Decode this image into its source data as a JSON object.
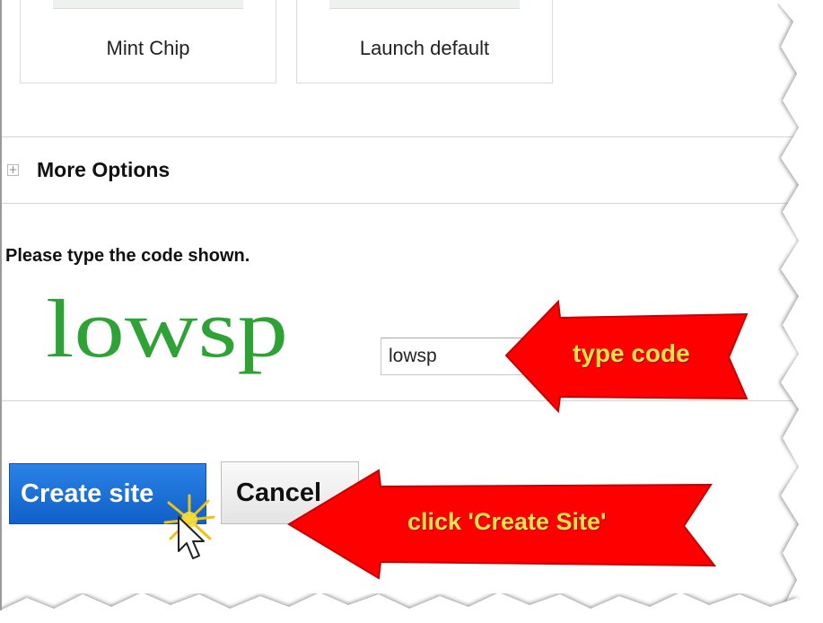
{
  "themes": [
    {
      "label": "Mint Chip"
    },
    {
      "label": "Launch default"
    }
  ],
  "more_options": {
    "label": "More Options",
    "expander_icon": "plus-square-icon"
  },
  "captcha": {
    "prompt": "Please type the code shown.",
    "image_text": "lowsp",
    "input_value": "lowsp"
  },
  "buttons": {
    "create": "Create site",
    "cancel": "Cancel"
  },
  "callouts": {
    "type_code": "type code",
    "click_create": "click 'Create Site'"
  },
  "colors": {
    "primary_button": "#1a6fd8",
    "callout_fill": "#ff0000",
    "callout_text": "#f5e34a",
    "captcha_green": "#2fa236"
  }
}
